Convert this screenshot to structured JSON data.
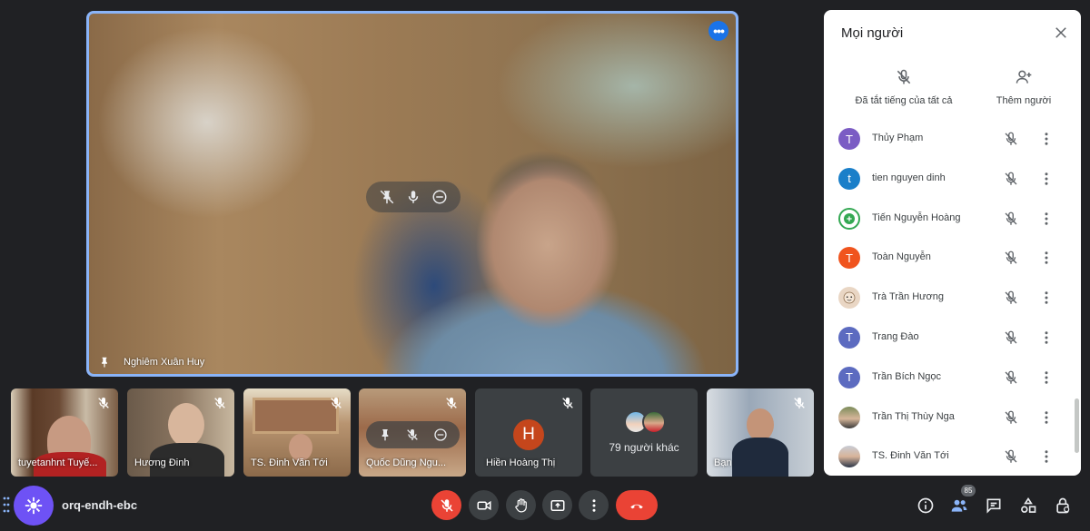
{
  "main_speaker": {
    "name": "Nghiêm Xuân Huy",
    "more_icon": "more-horiz-icon",
    "hover_controls": [
      "pin-off-icon",
      "mic-icon",
      "remove-circle-icon"
    ]
  },
  "tiles": [
    {
      "name": "tuyetanhnt Tuyế...",
      "muted": true
    },
    {
      "name": "Hương Đinh",
      "muted": true
    },
    {
      "name": "TS. Đinh Văn Tới",
      "muted": true
    },
    {
      "name": "Quốc Dũng Ngu...",
      "muted": true
    },
    {
      "name": "Hiền Hoàng Thị",
      "muted": true,
      "avatar_letter": "H"
    },
    {
      "name": "79 người khác"
    },
    {
      "name": "Bạn",
      "muted": true
    }
  ],
  "panel": {
    "title": "Mọi người",
    "actions": {
      "mute_all": "Đã tắt tiếng của tất cả",
      "add_people": "Thêm người"
    },
    "people": [
      {
        "name": "Thủy Phạm",
        "avatar_letter": "T",
        "avatar_color": "#7b5cc4"
      },
      {
        "name": "tien nguyen dinh",
        "avatar_letter": "t",
        "avatar_color": "#1a7fc9"
      },
      {
        "name": "Tiến Nguyễn Hoàng",
        "avatar_letter": "",
        "avatar_color": "#34a853"
      },
      {
        "name": "Toàn Nguyễn",
        "avatar_letter": "T",
        "avatar_color": "#f0541e"
      },
      {
        "name": "Trà Trần Hương",
        "avatar_letter": "",
        "avatar_color": "#e9d6c4"
      },
      {
        "name": "Trang Đào",
        "avatar_letter": "T",
        "avatar_color": "#5c6bc0"
      },
      {
        "name": "Trần Bích Ngọc",
        "avatar_letter": "T",
        "avatar_color": "#5c6bc0"
      },
      {
        "name": "Trần Thị Thùy Nga",
        "avatar_letter": "",
        "avatar_color": "#6d7b5a"
      },
      {
        "name": "TS. Đinh Văn Tới",
        "avatar_letter": "",
        "avatar_color": "#4a5568"
      }
    ]
  },
  "bottom_bar": {
    "meeting_code": "orq-endh-ebc",
    "people_count": "85",
    "colors": {
      "red": "#ea4335",
      "accent": "#1a73e8",
      "logo": "#6e52f5"
    }
  }
}
